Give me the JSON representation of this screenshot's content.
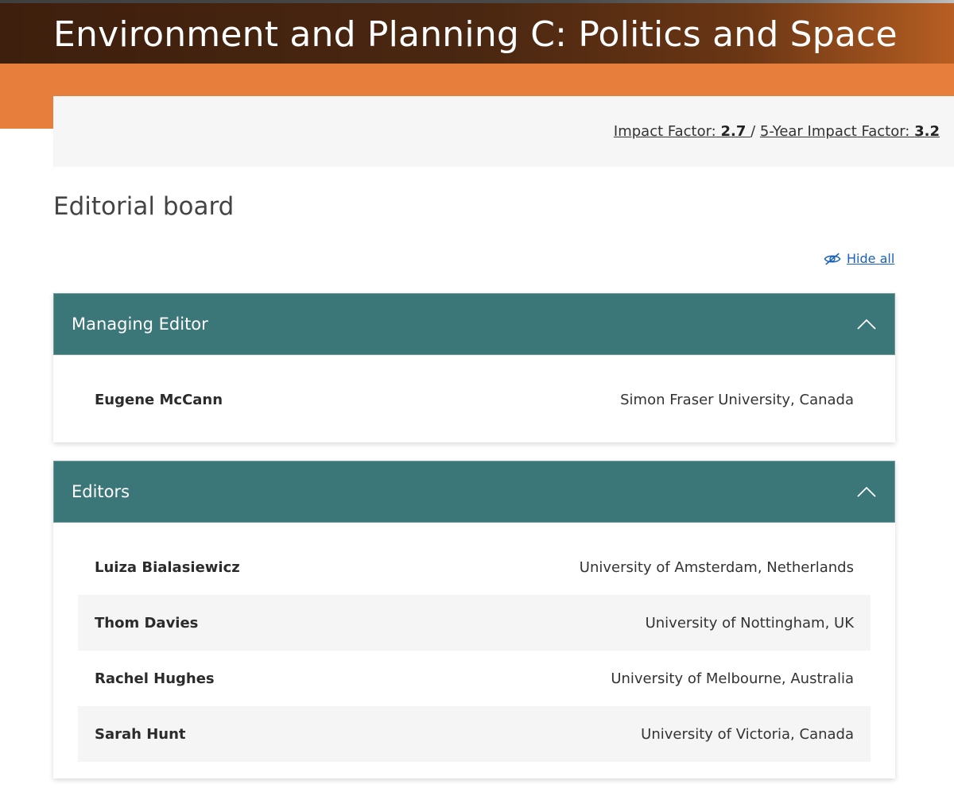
{
  "journal": {
    "title": "Environment and Planning C: Politics and Space"
  },
  "metrics": {
    "impact_factor_label": "Impact Factor:",
    "impact_factor_value": "2.7",
    "separator": "/",
    "five_year_label": "5-Year Impact Factor:",
    "five_year_value": "3.2"
  },
  "page": {
    "heading": "Editorial board",
    "hide_all_label": "Hide all",
    "hide_icon": "eye-slash-icon",
    "collapse_icon": "chevron-up-icon"
  },
  "colors": {
    "masthead": "#3e1f0d",
    "accent_orange": "#e87e3c",
    "panel_header": "#3b7678",
    "link": "#1a62b8"
  },
  "sections": [
    {
      "title": "Managing Editor",
      "members": [
        {
          "name": "Eugene McCann",
          "affiliation": "Simon Fraser University, Canada"
        }
      ]
    },
    {
      "title": "Editors",
      "members": [
        {
          "name": "Luiza Bialasiewicz",
          "affiliation": "University of Amsterdam, Netherlands"
        },
        {
          "name": "Thom Davies",
          "affiliation": "University of Nottingham, UK"
        },
        {
          "name": "Rachel Hughes",
          "affiliation": "University of Melbourne, Australia"
        },
        {
          "name": "Sarah Hunt",
          "affiliation": "University of Victoria, Canada"
        }
      ]
    }
  ]
}
